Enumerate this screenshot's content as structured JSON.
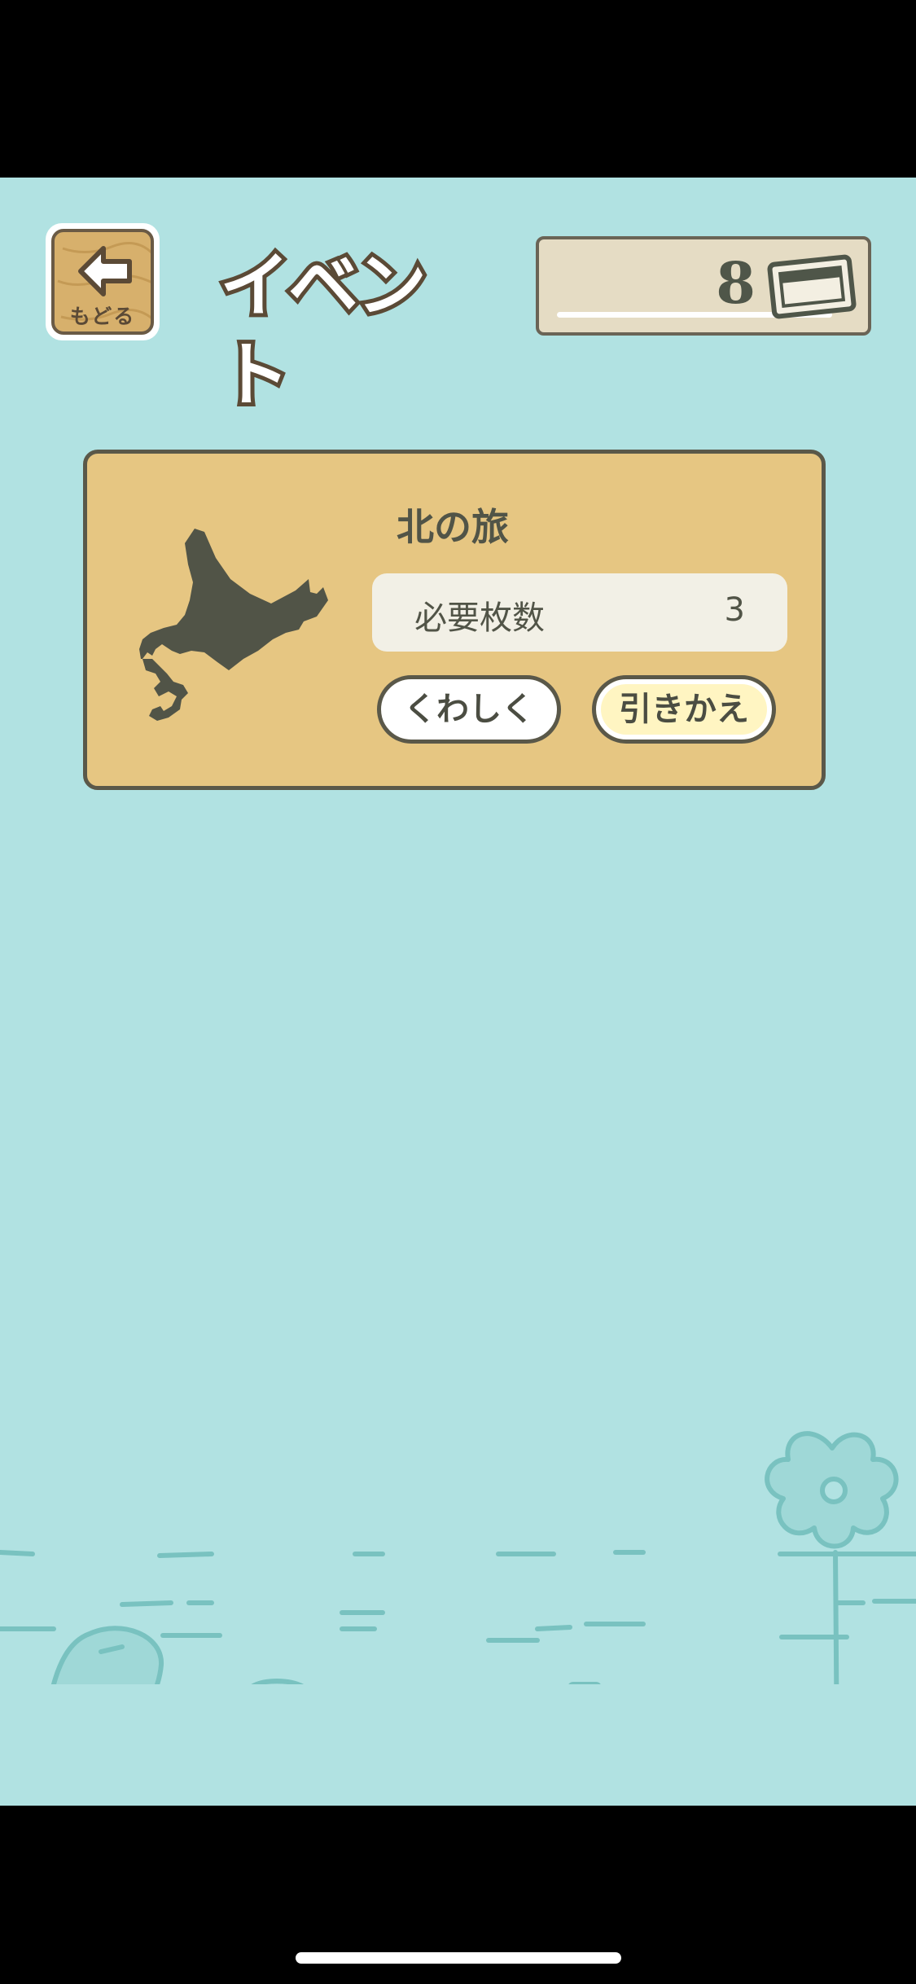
{
  "header": {
    "back_label": "もどる",
    "title": "イベント",
    "ticket_count": "8",
    "ticket_icon": "ticket-icon"
  },
  "event": {
    "title": "北の旅",
    "map_icon": "hokkaido-map-icon",
    "requirement_label": "必要枚数",
    "requirement_value": "3",
    "detail_button": "くわしく",
    "exchange_button": "引きかえ"
  },
  "colors": {
    "background": "#b1e2e2",
    "card": "#e6c682",
    "outline": "#5a5849",
    "title_outline": "#5b4a36"
  }
}
